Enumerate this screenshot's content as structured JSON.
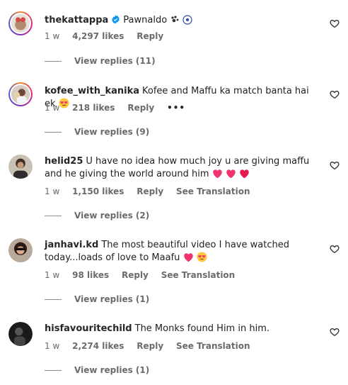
{
  "comments": [
    {
      "username": "thekattappa",
      "verified": true,
      "text": "Pawnaldo",
      "emojis": [
        "paw-prints",
        "soccer-ball"
      ],
      "time": "1 w",
      "likes": "4,297 likes",
      "reply": "Reply",
      "see_translation": "",
      "more": "",
      "view_replies": "View replies (11)"
    },
    {
      "username": "kofee_with_kanika",
      "verified": false,
      "text": "Kofee and Maffu ka match banta hai ek",
      "emojis": [
        "heart-eyes"
      ],
      "time": "1 w",
      "likes": "218 likes",
      "reply": "Reply",
      "see_translation": "",
      "more": "•••",
      "view_replies": "View replies (9)"
    },
    {
      "username": "helid25",
      "verified": false,
      "text": "U have no idea how much joy u are giving maffu and he giving the world around him",
      "emojis": [
        "pink-heart",
        "pink-heart",
        "red-heart"
      ],
      "time": "1 w",
      "likes": "1,150 likes",
      "reply": "Reply",
      "see_translation": "See Translation",
      "more": "",
      "view_replies": "View replies (2)"
    },
    {
      "username": "janhavi.kd",
      "verified": false,
      "text": "The most beautiful video I have watched today...loads of love to Maafu",
      "emojis": [
        "pink-heart",
        "heart-eyes"
      ],
      "time": "1 w",
      "likes": "98 likes",
      "reply": "Reply",
      "see_translation": "See Translation",
      "more": "",
      "view_replies": "View replies (1)"
    },
    {
      "username": "hisfavouritechild",
      "verified": false,
      "text": "The Monks found Him in him.",
      "emojis": [],
      "time": "1 w",
      "likes": "2,274 likes",
      "reply": "Reply",
      "see_translation": "See Translation",
      "more": "",
      "view_replies": "View replies (1)"
    }
  ],
  "colors": {
    "verified": "#0095f6",
    "secondary_text": "#6b6b6b",
    "primary_text": "#262626",
    "heart_emoji": "#f0356e"
  },
  "icons": {
    "like": "heart-outline-icon",
    "verified": "verified-badge-icon"
  }
}
